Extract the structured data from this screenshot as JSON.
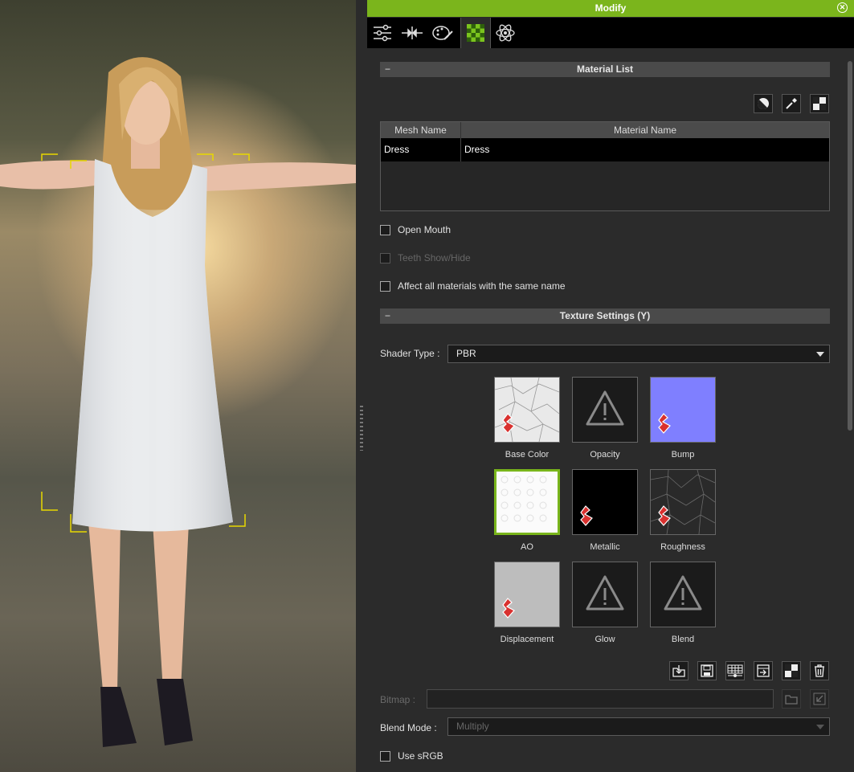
{
  "window": {
    "title": "Modify",
    "close_icon": "close-circle-icon",
    "accent": "#7bb51c"
  },
  "tabs": [
    {
      "icon": "sliders-icon",
      "active": false
    },
    {
      "icon": "morph-icon",
      "active": false
    },
    {
      "icon": "appearance-editor-icon",
      "active": false
    },
    {
      "icon": "material-checker-icon",
      "active": true
    },
    {
      "icon": "physics-atom-icon",
      "active": false
    }
  ],
  "material_list": {
    "header": "Material List",
    "toolbar_icons": [
      "material-ball-icon",
      "eyedropper-icon",
      "checker-pattern-icon"
    ],
    "columns": [
      "Mesh Name",
      "Material Name"
    ],
    "rows": [
      {
        "mesh": "Dress",
        "material": "Dress"
      }
    ]
  },
  "options": {
    "open_mouth": "Open Mouth",
    "teeth_show_hide": "Teeth Show/Hide",
    "affect_all": "Affect all materials with the same name"
  },
  "texture_settings": {
    "header": "Texture Settings  (Y)",
    "shader_type_label": "Shader Type :",
    "shader_type_value": "PBR",
    "channels": [
      {
        "name": "Base Color",
        "kind": "texture",
        "selected": false
      },
      {
        "name": "Opacity",
        "kind": "empty",
        "selected": false
      },
      {
        "name": "Bump",
        "kind": "texture",
        "selected": false
      },
      {
        "name": "AO",
        "kind": "texture",
        "selected": true
      },
      {
        "name": "Metallic",
        "kind": "texture",
        "selected": false
      },
      {
        "name": "Roughness",
        "kind": "texture",
        "selected": false
      },
      {
        "name": "Displacement",
        "kind": "texture",
        "selected": false
      },
      {
        "name": "Glow",
        "kind": "empty",
        "selected": false
      },
      {
        "name": "Blend",
        "kind": "empty",
        "selected": false
      }
    ],
    "action_icons": [
      "load-image-icon",
      "save-icon",
      "texture-grid-icon",
      "launch-editor-icon",
      "checker-pattern-icon",
      "trash-icon"
    ],
    "bitmap_label": "Bitmap :",
    "blend_mode_label": "Blend Mode :",
    "blend_mode_value": "Multiply",
    "use_srgb": "Use sRGB"
  },
  "colors": {
    "bump": "#7f7fff",
    "metallic": "#000000",
    "displacement": "#bdbdbd",
    "selection": "#79b51b"
  }
}
